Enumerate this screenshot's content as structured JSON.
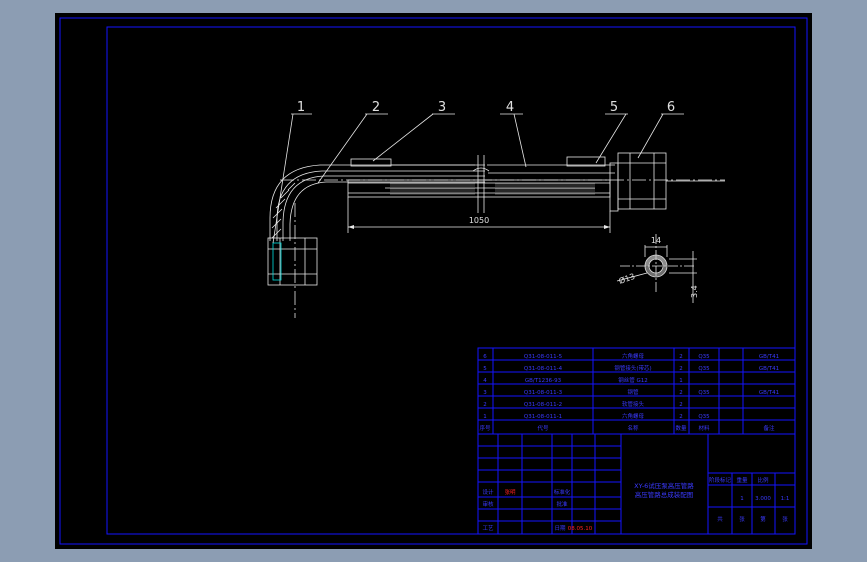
{
  "drawing": {
    "balloons": [
      "1",
      "2",
      "3",
      "4",
      "5",
      "6"
    ],
    "length_dim": "1050",
    "section_dim_top": "14",
    "section_dim_dia": "Ø13",
    "section_dim_side": "3.4"
  },
  "bom": {
    "rows": [
      {
        "no": "6",
        "code": "Q31-08-011-5",
        "name": "六角螺母",
        "qty": "2",
        "mat": "Q35",
        "note": "GB/T41"
      },
      {
        "no": "5",
        "code": "Q31-08-011-4",
        "name": "钢管接头(带芯)",
        "qty": "2",
        "mat": "Q35",
        "note": "GB/T41"
      },
      {
        "no": "4",
        "code": "GB/T1236-93",
        "name": "钢丝管 G12",
        "qty": "1",
        "mat": "",
        "note": ""
      },
      {
        "no": "3",
        "code": "Q31-08-011-3",
        "name": "钢管",
        "qty": "2",
        "mat": "Q35",
        "note": "GB/T41"
      },
      {
        "no": "2",
        "code": "Q31-08-011-2",
        "name": "软管接头",
        "qty": "2",
        "mat": "",
        "note": ""
      },
      {
        "no": "1",
        "code": "Q31-08-011-1",
        "name": "六角螺母",
        "qty": "2",
        "mat": "Q35",
        "note": ""
      }
    ],
    "header": {
      "no": "序号",
      "code": "代号",
      "name": "名称",
      "qty": "数量",
      "mat": "材料",
      "note": "备注"
    }
  },
  "title_block": {
    "title_line1": "XY-6试压泵高压管路",
    "title_line2": "高压管路总成装配图",
    "labels_left": [
      "设计",
      "审核",
      "工艺"
    ],
    "designer": "张明",
    "label_std": "标准化",
    "label_approve": "批准",
    "date_label": "日期",
    "date_value": "08.05.10",
    "stage_headers": [
      "阶段标记",
      "重量",
      "比例"
    ],
    "stage_values": [
      "1",
      "3.000",
      "1:1"
    ],
    "sheet_labels": [
      "共",
      "张",
      "第",
      "张"
    ]
  },
  "colors": {
    "background": "#8c9db3",
    "canvas": "#000000",
    "frame": "#1414ff",
    "geometry": "#e8e8e8",
    "accent": "#ff2020"
  }
}
